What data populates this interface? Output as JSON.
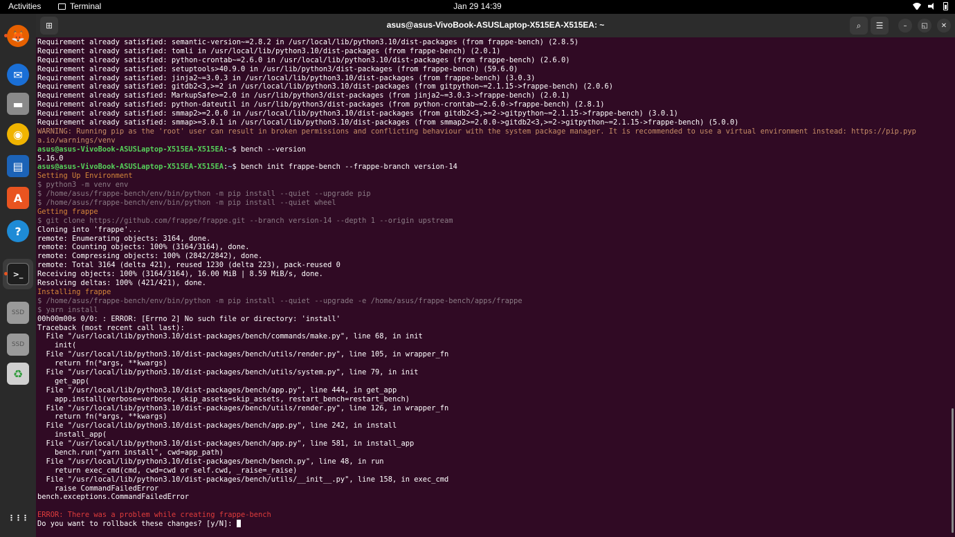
{
  "topbar": {
    "activities": "Activities",
    "app_name": "Terminal",
    "clock": "Jan 29  14:39"
  },
  "dock": {
    "items": [
      {
        "name": "firefox",
        "icon": "firefox-icon",
        "color": "#e66000"
      },
      {
        "name": "thunderbird",
        "icon": "thunderbird-icon",
        "color": "#1a6fd6"
      },
      {
        "name": "files",
        "icon": "files-icon",
        "color": "#8a8a8a"
      },
      {
        "name": "rhythmbox",
        "icon": "rhythmbox-icon",
        "color": "#f0b400"
      },
      {
        "name": "libreoffice-writer",
        "icon": "writer-icon",
        "color": "#1c63b7"
      },
      {
        "name": "software",
        "icon": "software-icon",
        "color": "#e95420"
      },
      {
        "name": "help",
        "icon": "help-icon",
        "color": "#1e8bd6"
      },
      {
        "name": "terminal",
        "icon": "terminal-icon",
        "color": "#3a3a3a"
      },
      {
        "name": "ssd-drive-1",
        "icon": "drive-icon",
        "label": "SSD",
        "color": "#9a9a9a"
      },
      {
        "name": "ssd-drive-2",
        "icon": "drive-icon",
        "label": "SSD",
        "color": "#9a9a9a"
      },
      {
        "name": "trash",
        "icon": "trash-icon",
        "color": "#d0d0d0"
      },
      {
        "name": "show-apps",
        "icon": "grid-icon",
        "color": "#ffffff"
      }
    ]
  },
  "window": {
    "title": "asus@asus-VivoBook-ASUSLaptop-X515EA-X515EA: ~"
  },
  "terminal": {
    "prompt_user": "asus@asus-VivoBook-ASUSLaptop-X515EA-X515EA",
    "prompt_path": "~",
    "lines": [
      {
        "t": "Requirement already satisfied: semantic-version~=2.8.2 in /usr/local/lib/python3.10/dist-packages (from frappe-bench) (2.8.5)",
        "c": ""
      },
      {
        "t": "Requirement already satisfied: tomli in /usr/local/lib/python3.10/dist-packages (from frappe-bench) (2.0.1)",
        "c": ""
      },
      {
        "t": "Requirement already satisfied: python-crontab~=2.6.0 in /usr/local/lib/python3.10/dist-packages (from frappe-bench) (2.6.0)",
        "c": ""
      },
      {
        "t": "Requirement already satisfied: setuptools>40.9.0 in /usr/lib/python3/dist-packages (from frappe-bench) (59.6.0)",
        "c": ""
      },
      {
        "t": "Requirement already satisfied: jinja2~=3.0.3 in /usr/local/lib/python3.10/dist-packages (from frappe-bench) (3.0.3)",
        "c": ""
      },
      {
        "t": "Requirement already satisfied: gitdb2<3,>=2 in /usr/local/lib/python3.10/dist-packages (from gitpython~=2.1.15->frappe-bench) (2.0.6)",
        "c": ""
      },
      {
        "t": "Requirement already satisfied: MarkupSafe>=2.0 in /usr/lib/python3/dist-packages (from jinja2~=3.0.3->frappe-bench) (2.0.1)",
        "c": ""
      },
      {
        "t": "Requirement already satisfied: python-dateutil in /usr/lib/python3/dist-packages (from python-crontab~=2.6.0->frappe-bench) (2.8.1)",
        "c": ""
      },
      {
        "t": "Requirement already satisfied: smmap2>=2.0.0 in /usr/local/lib/python3.10/dist-packages (from gitdb2<3,>=2->gitpython~=2.1.15->frappe-bench) (3.0.1)",
        "c": ""
      },
      {
        "t": "Requirement already satisfied: smmap>=3.0.1 in /usr/local/lib/python3.10/dist-packages (from smmap2>=2.0.0->gitdb2<3,>=2->gitpython~=2.1.15->frappe-bench) (5.0.0)",
        "c": ""
      },
      {
        "t": "WARNING: Running pip as the 'root' user can result in broken permissions and conflicting behaviour with the system package manager. It is recommended to use a virtual environment instead: https://pip.pyp",
        "c": "c-warn"
      },
      {
        "t": "a.io/warnings/venv",
        "c": "c-warn"
      },
      {
        "t": "$ bench --version",
        "c": "prompt"
      },
      {
        "t": "5.16.0",
        "c": ""
      },
      {
        "t": "$ bench init frappe-bench --frappe-branch version-14",
        "c": "prompt"
      },
      {
        "t": "Setting Up Environment",
        "c": "c-orange"
      },
      {
        "t": "$ python3 -m venv env",
        "c": "c-dim"
      },
      {
        "t": "$ /home/asus/frappe-bench/env/bin/python -m pip install --quiet --upgrade pip",
        "c": "c-dim"
      },
      {
        "t": "$ /home/asus/frappe-bench/env/bin/python -m pip install --quiet wheel",
        "c": "c-dim"
      },
      {
        "t": "Getting frappe",
        "c": "c-orange"
      },
      {
        "t": "$ git clone https://github.com/frappe/frappe.git --branch version-14 --depth 1 --origin upstream",
        "c": "c-dim"
      },
      {
        "t": "Cloning into 'frappe'...",
        "c": ""
      },
      {
        "t": "remote: Enumerating objects: 3164, done.",
        "c": ""
      },
      {
        "t": "remote: Counting objects: 100% (3164/3164), done.",
        "c": ""
      },
      {
        "t": "remote: Compressing objects: 100% (2842/2842), done.",
        "c": ""
      },
      {
        "t": "remote: Total 3164 (delta 421), reused 1230 (delta 223), pack-reused 0",
        "c": ""
      },
      {
        "t": "Receiving objects: 100% (3164/3164), 16.00 MiB | 8.59 MiB/s, done.",
        "c": ""
      },
      {
        "t": "Resolving deltas: 100% (421/421), done.",
        "c": ""
      },
      {
        "t": "Installing frappe",
        "c": "c-orange"
      },
      {
        "t": "$ /home/asus/frappe-bench/env/bin/python -m pip install --quiet --upgrade -e /home/asus/frappe-bench/apps/frappe",
        "c": "c-dim"
      },
      {
        "t": "$ yarn install",
        "c": "c-dim"
      },
      {
        "t": "00h00m00s 0/0: : ERROR: [Errno 2] No such file or directory: 'install'",
        "c": ""
      },
      {
        "t": "Traceback (most recent call last):",
        "c": ""
      },
      {
        "t": "  File \"/usr/local/lib/python3.10/dist-packages/bench/commands/make.py\", line 68, in init",
        "c": ""
      },
      {
        "t": "    init(",
        "c": ""
      },
      {
        "t": "  File \"/usr/local/lib/python3.10/dist-packages/bench/utils/render.py\", line 105, in wrapper_fn",
        "c": ""
      },
      {
        "t": "    return fn(*args, **kwargs)",
        "c": ""
      },
      {
        "t": "  File \"/usr/local/lib/python3.10/dist-packages/bench/utils/system.py\", line 79, in init",
        "c": ""
      },
      {
        "t": "    get_app(",
        "c": ""
      },
      {
        "t": "  File \"/usr/local/lib/python3.10/dist-packages/bench/app.py\", line 444, in get_app",
        "c": ""
      },
      {
        "t": "    app.install(verbose=verbose, skip_assets=skip_assets, restart_bench=restart_bench)",
        "c": ""
      },
      {
        "t": "  File \"/usr/local/lib/python3.10/dist-packages/bench/utils/render.py\", line 126, in wrapper_fn",
        "c": ""
      },
      {
        "t": "    return fn(*args, **kwargs)",
        "c": ""
      },
      {
        "t": "  File \"/usr/local/lib/python3.10/dist-packages/bench/app.py\", line 242, in install",
        "c": ""
      },
      {
        "t": "    install_app(",
        "c": ""
      },
      {
        "t": "  File \"/usr/local/lib/python3.10/dist-packages/bench/app.py\", line 581, in install_app",
        "c": ""
      },
      {
        "t": "    bench.run(\"yarn install\", cwd=app_path)",
        "c": ""
      },
      {
        "t": "  File \"/usr/local/lib/python3.10/dist-packages/bench/bench.py\", line 48, in run",
        "c": ""
      },
      {
        "t": "    return exec_cmd(cmd, cwd=cwd or self.cwd, _raise=_raise)",
        "c": ""
      },
      {
        "t": "  File \"/usr/local/lib/python3.10/dist-packages/bench/utils/__init__.py\", line 158, in exec_cmd",
        "c": ""
      },
      {
        "t": "    raise CommandFailedError",
        "c": ""
      },
      {
        "t": "bench.exceptions.CommandFailedError",
        "c": ""
      },
      {
        "t": "",
        "c": ""
      },
      {
        "t": "ERROR: There was a problem while creating frappe-bench",
        "c": "c-err"
      },
      {
        "t": "Do you want to rollback these changes? [y/N]: ",
        "c": "cursor"
      }
    ]
  }
}
